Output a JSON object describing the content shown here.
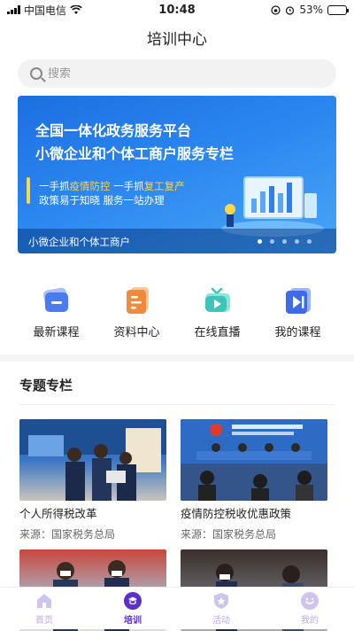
{
  "status_bar": {
    "carrier": "中国电信",
    "time": "10:48",
    "battery": "53%"
  },
  "header": {
    "title": "培训中心"
  },
  "search": {
    "placeholder": "搜索"
  },
  "banner": {
    "line1": "全国一体化政务服务平台",
    "line2": "小微企业和个体工商户服务专栏",
    "line3a": "一手抓",
    "line3b": "疫情防控",
    "line3c": "  一手抓",
    "line3d": "复工复产",
    "line4": "政策易于知晓   服务一站办理",
    "caption": "小微企业和个体工商户",
    "dot_count": 5,
    "active_dot": 0
  },
  "quick_menu": [
    {
      "label": "最新课程",
      "icon": "latest-course-icon",
      "color": "#4a7cf0"
    },
    {
      "label": "资料中心",
      "icon": "document-center-icon",
      "color": "#f08a3c"
    },
    {
      "label": "在线直播",
      "icon": "live-tv-icon",
      "color": "#3cc5b8"
    },
    {
      "label": "我的课程",
      "icon": "my-course-icon",
      "color": "#3d6be8"
    }
  ],
  "section": {
    "title": "专题专栏"
  },
  "cards": [
    {
      "title": "个人所得税改革",
      "source": "来源：国家税务总局"
    },
    {
      "title": "疫情防控税收优惠政策",
      "source": "来源：国家税务总局"
    },
    {
      "title": "",
      "source": ""
    },
    {
      "title": "",
      "source": ""
    }
  ],
  "tabbar": [
    {
      "label": "首页",
      "icon": "home-icon",
      "active": false
    },
    {
      "label": "培训",
      "icon": "training-icon",
      "active": true
    },
    {
      "label": "活动",
      "icon": "activity-icon",
      "active": false
    },
    {
      "label": "我的",
      "icon": "profile-icon",
      "active": false
    }
  ],
  "colors": {
    "accent": "#5b2fc9",
    "banner_blue": "#1d6fe0",
    "highlight": "#ffd54a"
  }
}
